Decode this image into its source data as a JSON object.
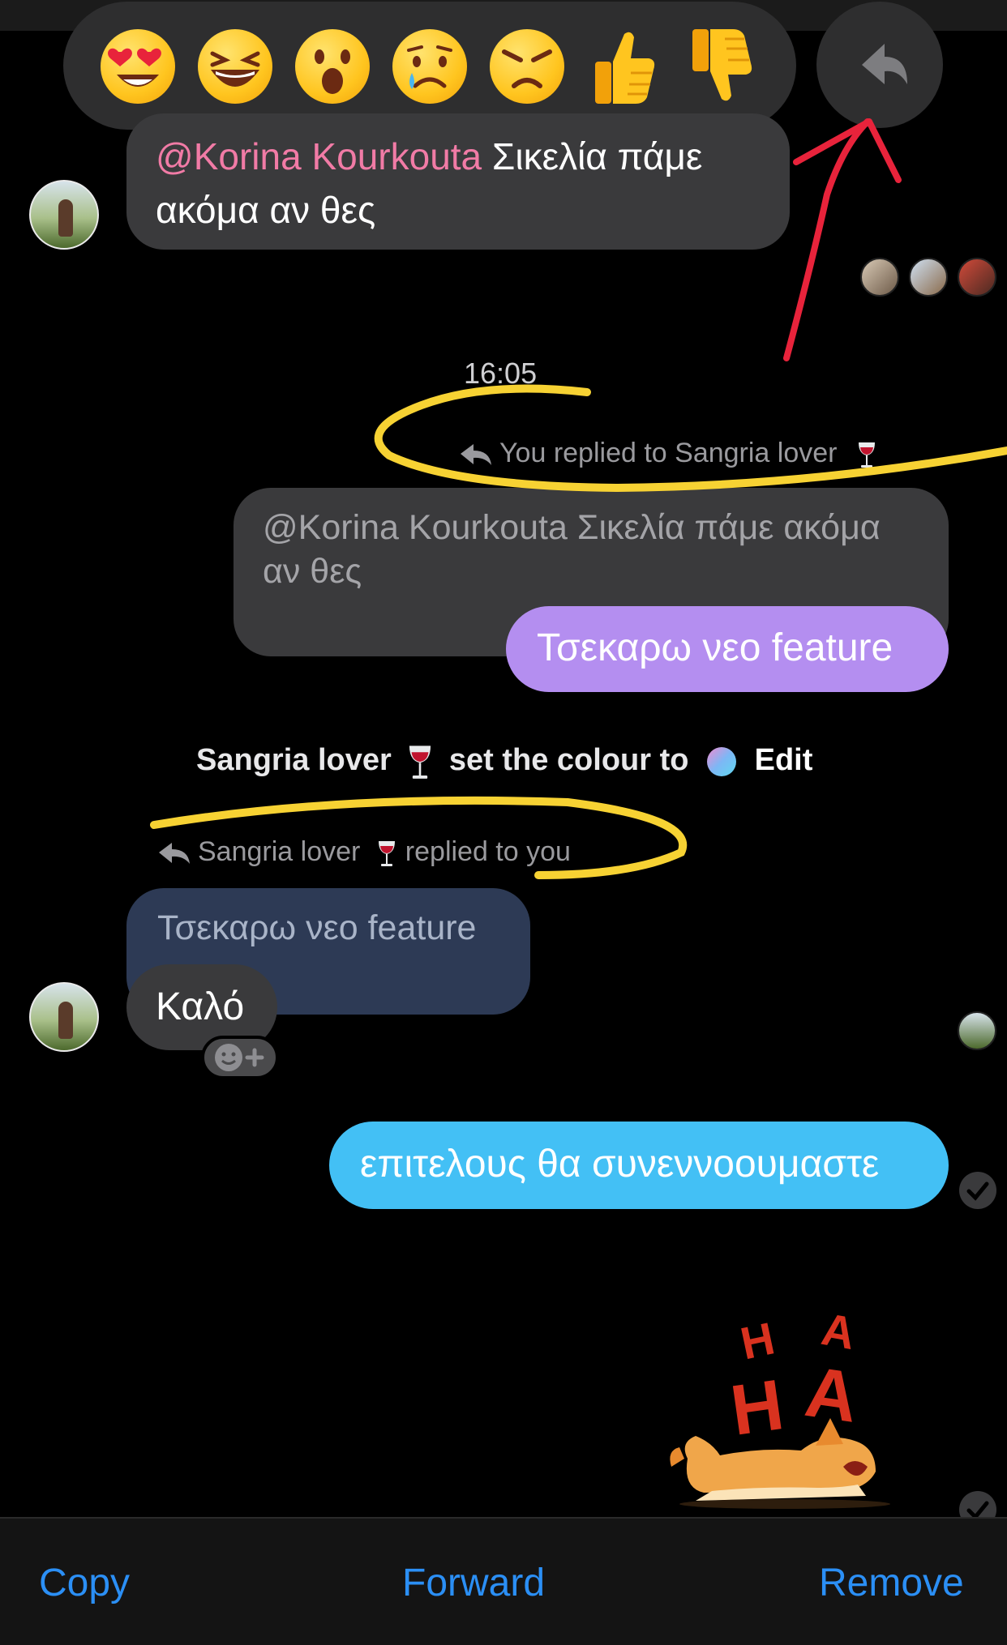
{
  "reactions": [
    "heart-eyes-emoji",
    "laughing-emoji",
    "surprised-emoji",
    "sad-emoji",
    "angry-emoji",
    "thumbs-up-emoji",
    "thumbs-down-emoji"
  ],
  "message_top": {
    "mention": "@Korina Kourkouta",
    "text": " Σικελία πάμε",
    "text_line2": "ακόμα αν θες"
  },
  "timestamp": "16:05",
  "reply_header_1": {
    "text": "You replied to Sangria lover"
  },
  "quoted_1": {
    "line1": "@Korina Kourkouta Σικελία πάμε ακόμα",
    "line2": "αν θες"
  },
  "my_reply_1": "Τσεκαρω νεο feature",
  "system_message": {
    "prefix": "Sangria lover",
    "middle": "set the colour to",
    "link": "Edit"
  },
  "reply_header_2": {
    "name": "Sangria lover",
    "text": "replied to you"
  },
  "quoted_2": "Τσεκαρω νεο feature",
  "their_reply": "Καλό",
  "my_message": "επιτελους θα συνεννοουμαστε",
  "sticker_text": [
    "H",
    "A",
    "H",
    "A"
  ],
  "actions": {
    "copy": "Copy",
    "forward": "Forward",
    "remove": "Remove"
  },
  "colors": {
    "accent_blue": "#2b8ff5",
    "bubble_purple": "#b48ef0",
    "bubble_cyan": "#43c0f5",
    "mention_pink": "#f17ba6",
    "annotation_red": "#e8233b",
    "annotation_yellow": "#f7d233"
  }
}
